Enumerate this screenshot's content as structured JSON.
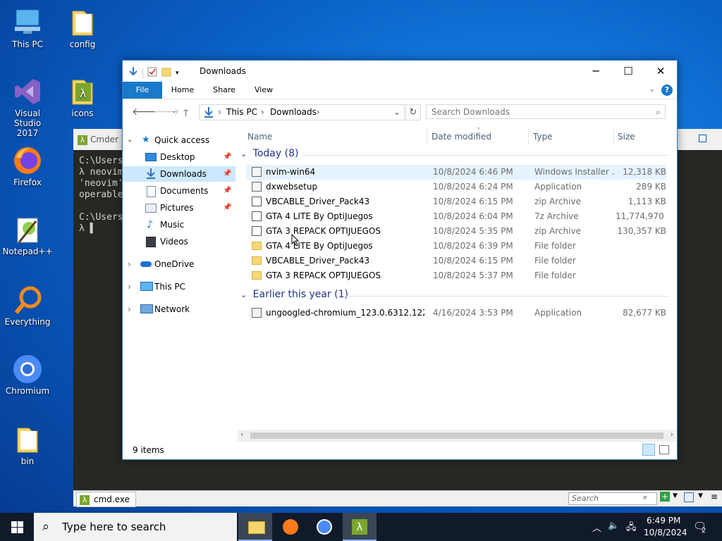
{
  "desktop": {
    "icons": [
      {
        "label": "This PC"
      },
      {
        "label": "config"
      },
      {
        "label": "Visual Studio 2017"
      },
      {
        "label": "icons"
      },
      {
        "label": "Firefox"
      },
      {
        "label": "Notepad++"
      },
      {
        "label": "Everything"
      },
      {
        "label": "Chromium"
      },
      {
        "label": "bin"
      }
    ]
  },
  "cmder": {
    "title": "Cmder",
    "lines": "C:\\Users\nλ neovim\n'neovim'\noperable\n\nC:\\Users\nλ ▌",
    "tab_label": "cmd.exe",
    "search_placeholder": "Search"
  },
  "explorer": {
    "title": "Downloads",
    "ribbon_tabs": [
      "File",
      "Home",
      "Share",
      "View"
    ],
    "address": {
      "segments": [
        "This PC",
        "Downloads"
      ]
    },
    "search_placeholder": "Search Downloads",
    "nav": {
      "quick_access": "Quick access",
      "quick_items": [
        "Desktop",
        "Downloads",
        "Documents",
        "Pictures",
        "Music",
        "Videos"
      ],
      "onedrive": "OneDrive",
      "this_pc": "This PC",
      "network": "Network"
    },
    "columns": {
      "name": "Name",
      "date": "Date modified",
      "type": "Type",
      "size": "Size"
    },
    "groups": [
      {
        "label": "Today (8)",
        "rows": [
          {
            "name": "nvim-win64",
            "date": "10/8/2024 6:46 PM",
            "type": "Windows Installer ...",
            "size": "12,318 KB",
            "icon": "installer-icon"
          },
          {
            "name": "dxwebsetup",
            "date": "10/8/2024 6:24 PM",
            "type": "Application",
            "size": "289 KB",
            "icon": "application-icon"
          },
          {
            "name": "VBCABLE_Driver_Pack43",
            "date": "10/8/2024 6:15 PM",
            "type": "zip Archive",
            "size": "1,113 KB",
            "icon": "zip-icon"
          },
          {
            "name": "GTA 4 LITE By OptiJuegos",
            "date": "10/8/2024 6:04 PM",
            "type": "7z Archive",
            "size": "11,774,970 ...",
            "icon": "zip-icon"
          },
          {
            "name": "GTA 3 REPACK OPTIJUEGOS",
            "date": "10/8/2024 5:35 PM",
            "type": "zip Archive",
            "size": "130,357 KB",
            "icon": "zip-icon"
          },
          {
            "name": "GTA 4 LITE By OptiJuegos",
            "date": "10/8/2024 6:39 PM",
            "type": "File folder",
            "size": "",
            "icon": "folder-icon"
          },
          {
            "name": "VBCABLE_Driver_Pack43",
            "date": "10/8/2024 6:15 PM",
            "type": "File folder",
            "size": "",
            "icon": "folder-icon"
          },
          {
            "name": "GTA 3 REPACK OPTIJUEGOS",
            "date": "10/8/2024 5:37 PM",
            "type": "File folder",
            "size": "",
            "icon": "folder-icon"
          }
        ]
      },
      {
        "label": "Earlier this year (1)",
        "rows": [
          {
            "name": "ungoogled-chromium_123.0.6312.122-1....",
            "date": "4/16/2024 3:53 PM",
            "type": "Application",
            "size": "82,677 KB",
            "icon": "application-icon"
          }
        ]
      }
    ],
    "status": "9 items"
  },
  "taskbar": {
    "search_placeholder": "Type here to search",
    "time": "6:49 PM",
    "date": "10/8/2024",
    "notification_count": "2"
  }
}
